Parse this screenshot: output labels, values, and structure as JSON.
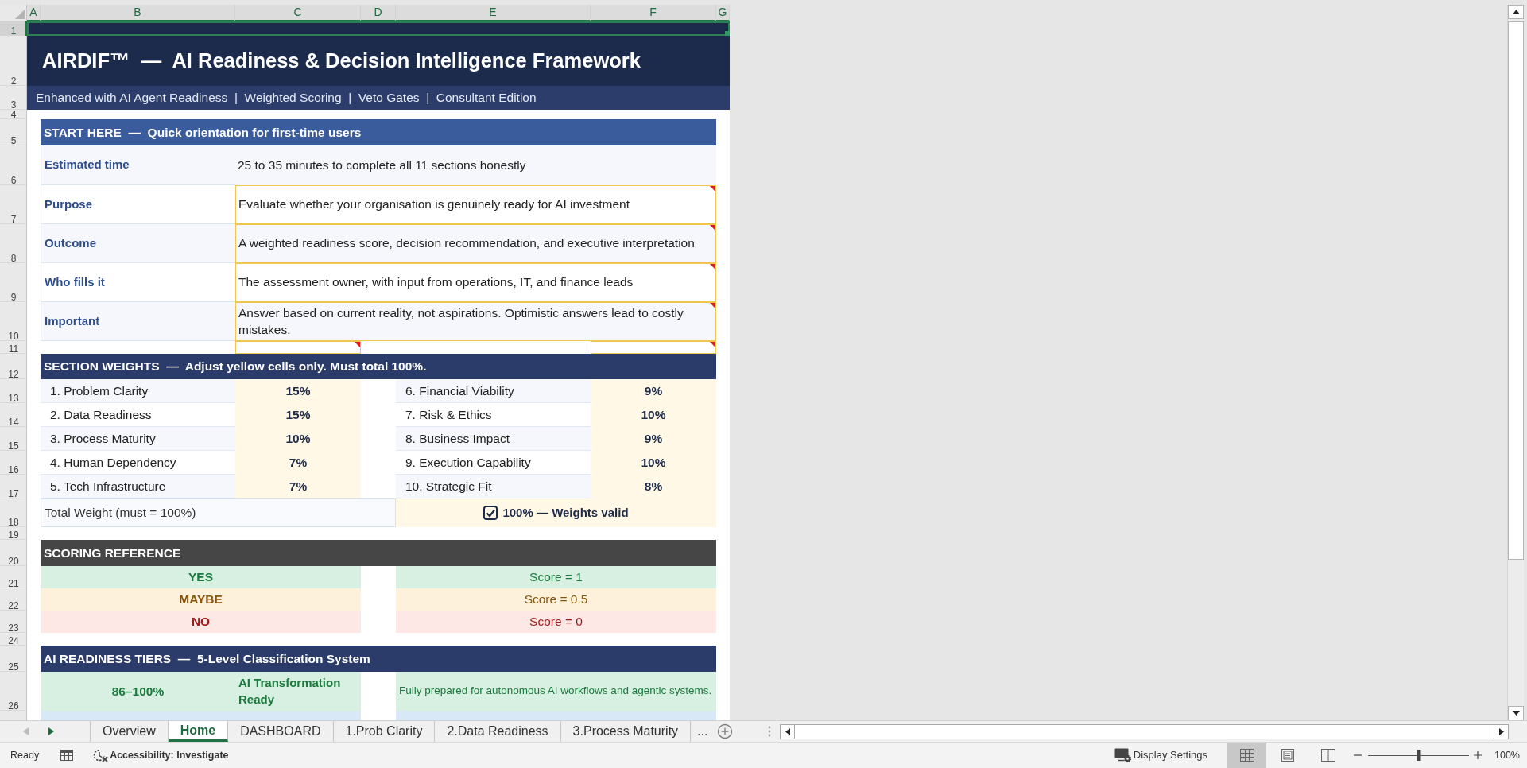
{
  "sheet": {
    "column_headers": [
      {
        "label": "A",
        "selected": true
      },
      {
        "label": "B",
        "selected": true
      },
      {
        "label": "C",
        "selected": true
      },
      {
        "label": "D",
        "selected": true
      },
      {
        "label": "E",
        "selected": true
      },
      {
        "label": "F",
        "selected": true
      },
      {
        "label": "G",
        "selected": true
      }
    ],
    "row_headers": [
      {
        "label": "1",
        "selected": true
      },
      {
        "label": "2",
        "selected": false
      },
      {
        "label": "3",
        "selected": false
      },
      {
        "label": "4",
        "selected": false
      },
      {
        "label": "5",
        "selected": false
      },
      {
        "label": "6",
        "selected": false
      },
      {
        "label": "7",
        "selected": false
      },
      {
        "label": "8",
        "selected": false
      },
      {
        "label": "9",
        "selected": false
      },
      {
        "label": "10",
        "selected": false
      },
      {
        "label": "11",
        "selected": false
      },
      {
        "label": "12",
        "selected": false
      },
      {
        "label": "13",
        "selected": false
      },
      {
        "label": "14",
        "selected": false
      },
      {
        "label": "15",
        "selected": false
      },
      {
        "label": "16",
        "selected": false
      },
      {
        "label": "17",
        "selected": false
      },
      {
        "label": "18",
        "selected": false
      },
      {
        "label": "19",
        "selected": false
      },
      {
        "label": "20",
        "selected": false
      },
      {
        "label": "21",
        "selected": false
      },
      {
        "label": "22",
        "selected": false
      },
      {
        "label": "23",
        "selected": false
      },
      {
        "label": "24",
        "selected": false
      },
      {
        "label": "25",
        "selected": false
      },
      {
        "label": "26",
        "selected": false
      }
    ]
  },
  "banner": {
    "selected": true,
    "title": "AIRDIF™  —  AI Readiness & Decision Intelligence Framework",
    "subtitle": "Enhanced with AI Agent Readiness  |  Weighted Scoring  |  Veto Gates  |  Consultant Edition"
  },
  "start_here": {
    "heading": "START HERE  —  Quick orientation for first-time users",
    "rows": [
      {
        "kind": "info",
        "label": "Estimated time",
        "value": "25 to 35 minutes to complete all 11 sections honestly",
        "note": false
      },
      {
        "kind": "input",
        "label": "Purpose",
        "value": "Evaluate whether your organisation is genuinely ready for AI investment",
        "note": true
      },
      {
        "kind": "input",
        "label": "Outcome",
        "value": "A weighted readiness score, decision recommendation, and executive interpretation",
        "note": true
      },
      {
        "kind": "input",
        "label": "Who fills it",
        "value": "The assessment owner, with input from operations, IT, and finance leads",
        "note": true
      },
      {
        "kind": "input",
        "label": "Important",
        "value": "Answer based on current reality, not aspirations. Optimistic answers lead to costly mistakes.",
        "note": true
      }
    ],
    "spacer_notes": [
      false,
      true,
      false,
      false,
      true
    ]
  },
  "section_weights": {
    "heading": "SECTION WEIGHTS  —  Adjust yellow cells only. Must total 100%.",
    "left": [
      {
        "name": "1. Problem Clarity",
        "weight": "15%"
      },
      {
        "name": "2. Data Readiness",
        "weight": "15%"
      },
      {
        "name": "3. Process Maturity",
        "weight": "10%"
      },
      {
        "name": "4. Human Dependency",
        "weight": "7%"
      },
      {
        "name": "5. Tech Infrastructure",
        "weight": "7%"
      }
    ],
    "right": [
      {
        "name": "6. Financial Viability",
        "weight": "9%"
      },
      {
        "name": "7. Risk & Ethics",
        "weight": "10%"
      },
      {
        "name": "8. Business Impact",
        "weight": "9%"
      },
      {
        "name": "9. Execution Capability",
        "weight": "10%"
      },
      {
        "name": "10. Strategic Fit",
        "weight": "8%"
      }
    ],
    "total": {
      "label": "Total Weight (must = 100%)",
      "status": "100% — Weights valid",
      "valid": true
    }
  },
  "scoring_reference": {
    "heading": "SCORING REFERENCE",
    "rows": [
      {
        "kind": "yes",
        "answer": "YES",
        "score": "Score = 1"
      },
      {
        "kind": "maybe",
        "answer": "MAYBE",
        "score": "Score = 0.5"
      },
      {
        "kind": "no",
        "answer": "NO",
        "score": "Score = 0"
      }
    ]
  },
  "readiness_tiers": {
    "heading": "AI READINESS TIERS  —  5-Level Classification System",
    "rows": [
      {
        "kind": "green",
        "range": "86–100%",
        "name": "AI Transformation Ready",
        "description": "Fully prepared for autonomous AI workflows and agentic systems."
      },
      {
        "kind": "blue"
      }
    ]
  },
  "sheet_tabs": {
    "nav_buttons": [
      {
        "disabled": true
      },
      {
        "disabled": false
      }
    ],
    "items": [
      {
        "label": "Overview",
        "selected": false
      },
      {
        "label": "Home",
        "selected": true
      },
      {
        "label": "DASHBOARD",
        "selected": false
      },
      {
        "label": "1.Prob Clarity",
        "selected": false
      },
      {
        "label": "2.Data Readiness",
        "selected": false
      },
      {
        "label": "3.Process Maturity",
        "selected": false
      }
    ],
    "more": "..."
  },
  "status_bar": {
    "mode": "Ready",
    "accessibility": "Accessibility: Investigate",
    "display_settings": "Display Settings",
    "views": [
      {
        "selected": true
      },
      {
        "selected": false
      },
      {
        "selected": false
      }
    ],
    "zoom": {
      "level": 0.5,
      "reading": "100%"
    }
  }
}
